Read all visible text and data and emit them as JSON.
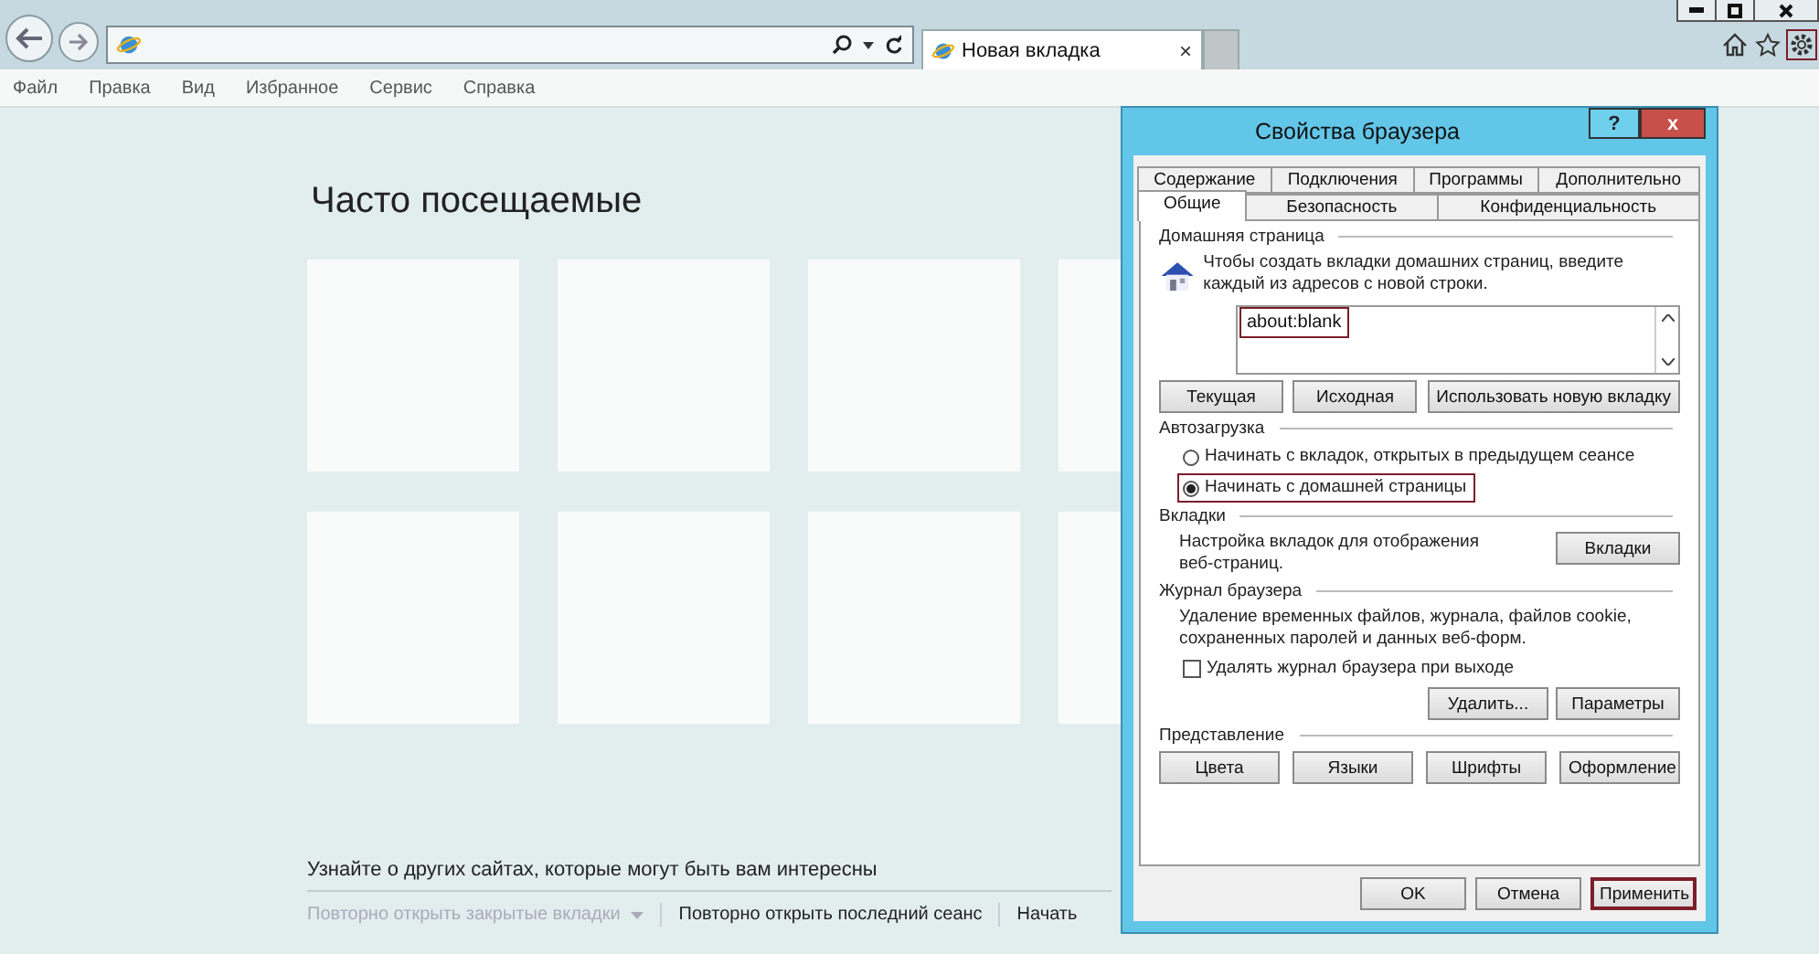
{
  "toolbar": {
    "tab_title": "Новая вкладка",
    "tab_close": "×",
    "settings_highlighted": true
  },
  "menu": [
    "Файл",
    "Правка",
    "Вид",
    "Избранное",
    "Сервис",
    "Справка"
  ],
  "page": {
    "heading": "Часто посещаемые",
    "discover_text": "Узнайте о других сайтах, которые могут быть вам интересны",
    "links": [
      {
        "label": "Повторно открыть закрытые вкладки",
        "disabled": true,
        "dropdown": true
      },
      {
        "label": "Повторно открыть последний сеанс",
        "disabled": false,
        "dropdown": false
      },
      {
        "label": "Начать",
        "disabled": false,
        "dropdown": false
      }
    ]
  },
  "dialog": {
    "title": "Свойства браузера",
    "help": "?",
    "close": "x",
    "tab_rows": [
      [
        {
          "label": "Содержание",
          "selected": false
        },
        {
          "label": "Подключения",
          "selected": false
        },
        {
          "label": "Программы",
          "selected": false
        },
        {
          "label": "Дополнительно",
          "selected": false
        }
      ],
      [
        {
          "label": "Общие",
          "selected": true
        },
        {
          "label": "Безопасность",
          "selected": false
        },
        {
          "label": "Конфиденциальность",
          "selected": false
        }
      ]
    ],
    "home": {
      "legend": "Домашняя страница",
      "hint": "Чтобы создать вкладки домашних страниц, введите каждый из адресов с новой строки.",
      "value": "about:blank",
      "value_highlighted": true,
      "buttons": [
        "Текущая",
        "Исходная",
        "Использовать новую вкладку"
      ]
    },
    "startup": {
      "legend": "Автозагрузка",
      "options": [
        {
          "label": "Начинать с вкладок, открытых в предыдущем сеансе",
          "selected": false,
          "highlighted": false
        },
        {
          "label": "Начинать с домашней страницы",
          "selected": true,
          "highlighted": true
        }
      ]
    },
    "tabs": {
      "legend": "Вкладки",
      "text": "Настройка вкладок для отображения веб-страниц.",
      "button": "Вкладки"
    },
    "history": {
      "legend": "Журнал браузера",
      "text": "Удаление временных файлов, журнала, файлов cookie, сохраненных паролей и данных веб-форм.",
      "checkbox": {
        "label": "Удалять журнал браузера при выходе",
        "checked": false
      },
      "buttons": [
        "Удалить...",
        "Параметры"
      ]
    },
    "appearance": {
      "legend": "Представление",
      "buttons": [
        "Цвета",
        "Языки",
        "Шрифты",
        "Оформление"
      ]
    },
    "footer": [
      {
        "label": "OK",
        "highlighted": false
      },
      {
        "label": "Отмена",
        "highlighted": false
      },
      {
        "label": "Применить",
        "highlighted": true
      }
    ]
  }
}
